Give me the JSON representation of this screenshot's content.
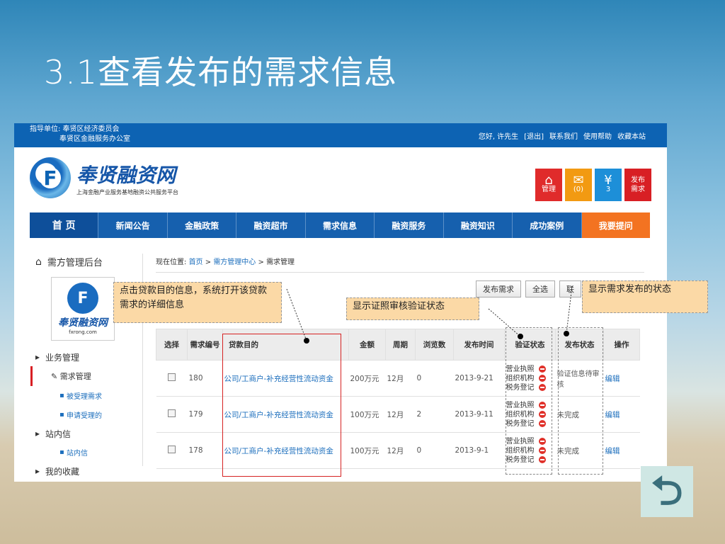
{
  "slide": {
    "title": "3.1查看发布的需求信息"
  },
  "topbar": {
    "org_line1": "指导单位: 奉贤区经济委员会",
    "org_line2": "奉贤区金融服务办公室",
    "greeting": "您好, 许先生",
    "logout": "[退出]",
    "contact": "联系我们",
    "help": "使用帮助",
    "bookmark": "收藏本站"
  },
  "logo": {
    "name": "奉贤融资网",
    "subtitle": "上海金融产业服务基地融资公共服务平台"
  },
  "quick": {
    "manage": "管理",
    "msg_count": "(0)",
    "money_count": "3",
    "publish_line1": "发布",
    "publish_line2": "需求"
  },
  "nav": [
    "首 页",
    "新闻公告",
    "金融政策",
    "融资超市",
    "需求信息",
    "融资服务",
    "融资知识",
    "成功案例",
    "我要提问"
  ],
  "side": {
    "header": "需方管理后台",
    "box_name": "奉贤融资网",
    "box_url": "fxrong.com",
    "menu": {
      "g1": "业务管理",
      "s1": "需求管理",
      "b1": "被受理需求",
      "b2": "申请受理的",
      "g2": "站内信",
      "b3": "站内信",
      "g3": "我的收藏"
    }
  },
  "crumb": {
    "prefix": "现在位置: ",
    "home": "首页",
    "center": "需方管理中心",
    "current": "需求管理"
  },
  "buttons": {
    "publish": "发布需求",
    "select_all": "全选",
    "partial": "联"
  },
  "table": {
    "headers": [
      "选择",
      "需求编号",
      "贷款目的",
      "金额",
      "周期",
      "浏览数",
      "发布时间",
      "验证状态",
      "发布状态",
      "操作"
    ],
    "rows": [
      {
        "id": "180",
        "purpose": "公司/工商户-补充经营性流动资金",
        "amount": "200万元",
        "period": "12月",
        "views": "0",
        "date": "2013-9-21",
        "status": "验证信息待审核",
        "op": "编辑"
      },
      {
        "id": "179",
        "purpose": "公司/工商户-补充经营性流动资金",
        "amount": "100万元",
        "period": "12月",
        "views": "2",
        "date": "2013-9-11",
        "status": "未完成",
        "op": "编辑"
      },
      {
        "id": "178",
        "purpose": "公司/工商户-补充经营性流动资金",
        "amount": "100万元",
        "period": "12月",
        "views": "0",
        "date": "2013-9-1",
        "status": "未完成",
        "op": "编辑"
      }
    ],
    "verify_items": [
      "营业执照",
      "组织机构",
      "税务登记"
    ]
  },
  "notes": {
    "n1": "点击贷款目的信息，系统打开该贷款需求的详细信息",
    "n2": "显示证照审核验证状态",
    "n3": "显示需求发布的状态"
  },
  "colors": {
    "nav": "#1660ae",
    "accent": "#f37321",
    "note": "#fbd9a6"
  }
}
